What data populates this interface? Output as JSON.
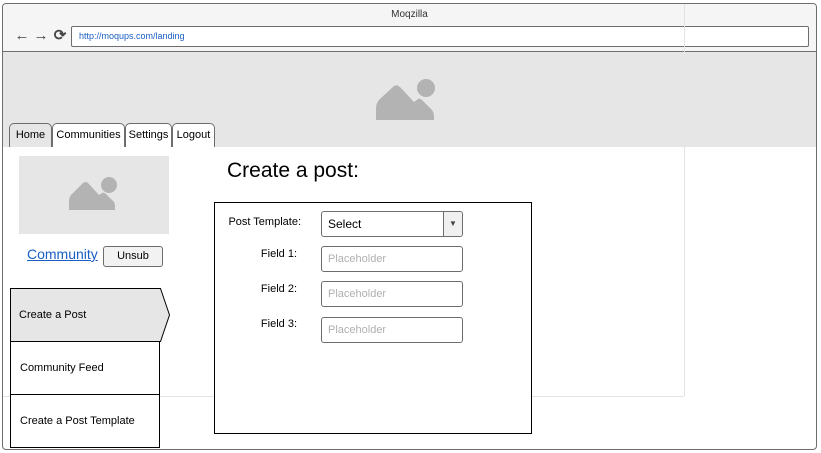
{
  "window": {
    "title": "Moqzilla",
    "url": "http://moqups.com/landing"
  },
  "nav": {
    "back": "←",
    "forward": "→",
    "reload": "⟳"
  },
  "tabs": [
    {
      "label": "Home"
    },
    {
      "label": "Communities"
    },
    {
      "label": "Settings"
    },
    {
      "label": "Logout"
    }
  ],
  "sidebar": {
    "community_link": "Community",
    "unsub_label": "Unsub",
    "items": [
      {
        "label": "Create a Post"
      },
      {
        "label": "Community Feed"
      },
      {
        "label": "Create a Post Template"
      }
    ]
  },
  "main": {
    "title": "Create a post:",
    "form": {
      "template_label": "Post Template:",
      "template_value": "Select",
      "select_arrow": "▼",
      "fields": [
        {
          "label": "Field 1:",
          "placeholder": "Placeholder"
        },
        {
          "label": "Field 2:",
          "placeholder": "Placeholder"
        },
        {
          "label": "Field 3:",
          "placeholder": "Placeholder"
        }
      ]
    }
  },
  "colors": {
    "accent_link": "#1a5fc4",
    "placeholder_gray": "#e6e6e6",
    "border": "#6d6d6d"
  }
}
